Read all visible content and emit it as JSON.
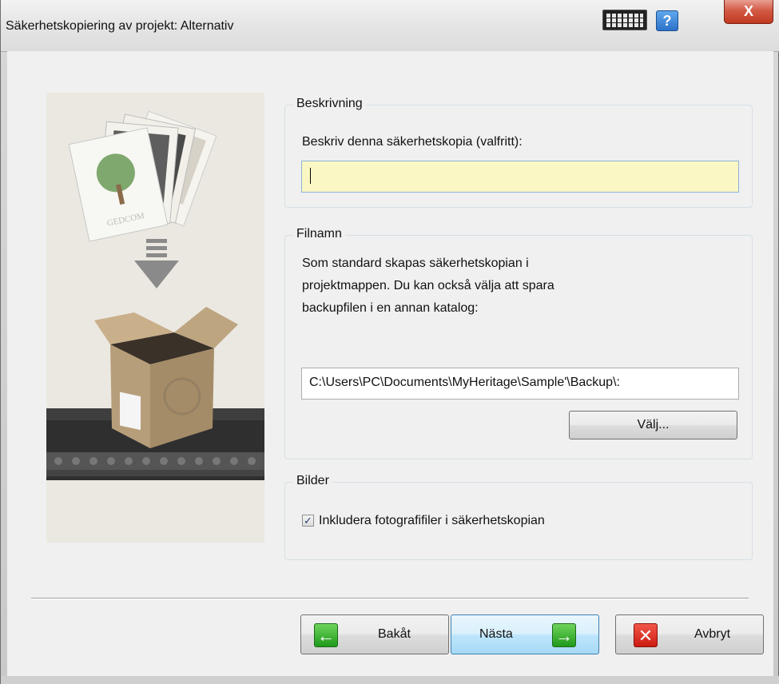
{
  "window": {
    "title": "Säkerhetskopiering av projekt: Alternativ",
    "help_label": "?",
    "close_label": "X"
  },
  "description": {
    "group_label": "Beskrivning",
    "prompt": "Beskriv denna säkerhetskopia (valfritt):",
    "value": ""
  },
  "filename": {
    "group_label": "Filnamn",
    "info_line1": "Som standard skapas säkerhetskopian i",
    "info_line2": "projektmappen. Du kan också välja att spara",
    "info_line3": "backupfilen i en annan katalog:",
    "path_value": "C:\\Users\\PC\\Documents\\MyHeritage\\Sample'\\Backup\\:",
    "choose_label": "Välj..."
  },
  "pictures": {
    "group_label": "Bilder",
    "include_photos_label": "Inkludera fotografifiler i säkerhetskopian",
    "include_photos_checked": true
  },
  "illustration": {
    "card_text": "GEDCOM"
  },
  "footer": {
    "back_label": "Bakåt",
    "next_label": "Nästa",
    "cancel_label": "Avbryt"
  },
  "colors": {
    "input_highlight": "#fbf7c4",
    "back_icon": "#1f9a1b",
    "next_icon": "#1f9a1b",
    "cancel_icon": "#cc1a10"
  }
}
